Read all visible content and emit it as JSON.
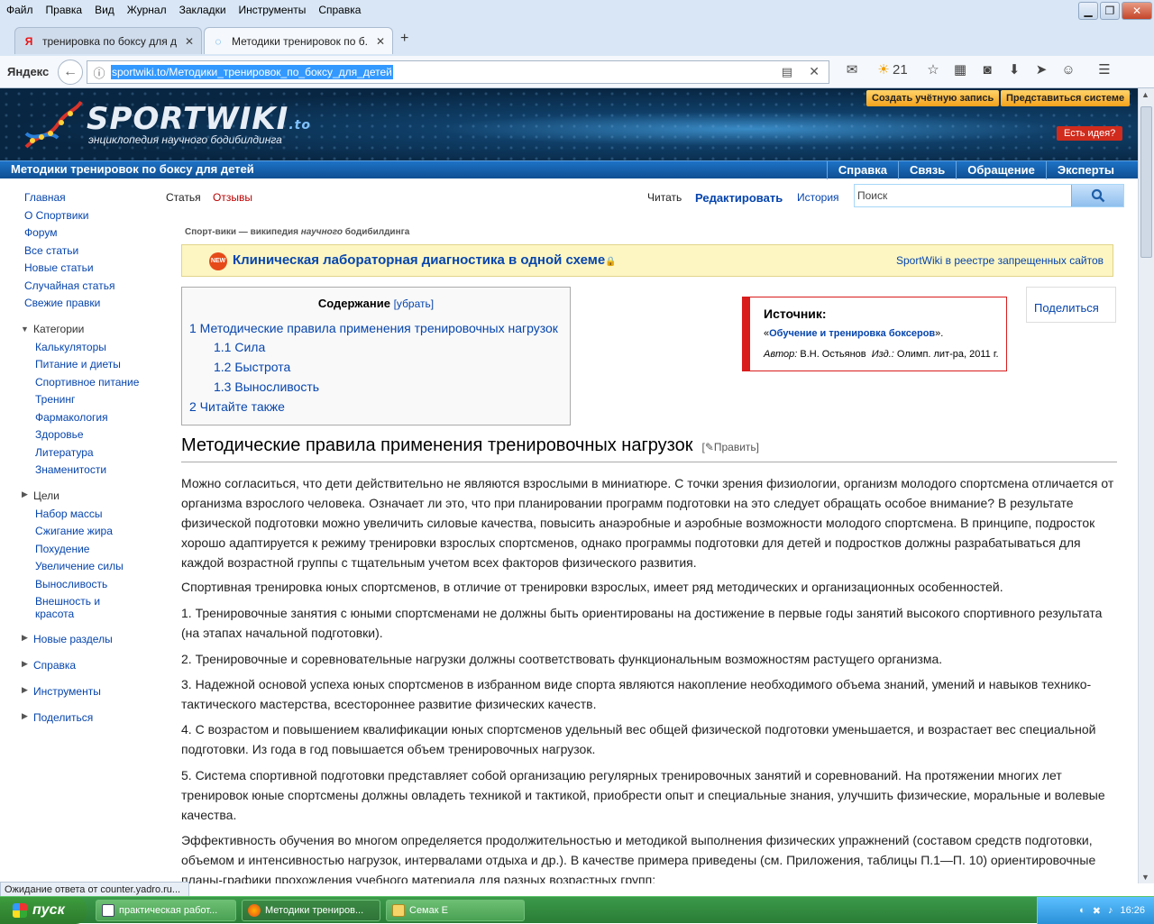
{
  "menu": [
    "Файл",
    "Правка",
    "Вид",
    "Журнал",
    "Закладки",
    "Инструменты",
    "Справка"
  ],
  "tabs": [
    {
      "label": "тренировка по боксу для д...",
      "favicon": "Я"
    },
    {
      "label": "Методики тренировок по б...",
      "favicon": "◌"
    }
  ],
  "nav": {
    "brand": "Яндекс",
    "url": "sportwiki.to/Методики_тренировок_по_боксу_для_детей",
    "weather": "21"
  },
  "site": {
    "logo": "SPORTWIKI",
    "logo_tld": ".to",
    "tagline": "энциклопедия научного бодибилдинга",
    "create_account": "Создать учётную запись",
    "login": "Представиться системе",
    "idea": "Есть идея?",
    "page_title": "Методики тренировок по боксу для детей",
    "top_links": [
      "Справка",
      "Связь",
      "Обращение",
      "Эксперты"
    ]
  },
  "sidebar": {
    "main": [
      "Главная",
      "О Спортвики",
      "Форум",
      "Все статьи",
      "Новые статьи",
      "Случайная статья",
      "Свежие правки"
    ],
    "categories_label": "Категории",
    "categories": [
      "Калькуляторы",
      "Питание и диеты",
      "Спортивное питание",
      "Тренинг",
      "Фармакология",
      "Здоровье",
      "Литература",
      "Знаменитости"
    ],
    "goals_label": "Цели",
    "goals": [
      "Набор массы",
      "Сжигание жира",
      "Похудение",
      "Увеличение силы",
      "Выносливость",
      "Внешность и",
      "красота"
    ],
    "sections": [
      "Новые разделы",
      "Справка",
      "Инструменты",
      "Поделиться"
    ]
  },
  "page_tabs": {
    "article": "Статья",
    "reviews": "Отзывы",
    "read": "Читать",
    "edit": "Редактировать",
    "history": "История",
    "search_placeholder": "Поиск"
  },
  "motto_pre": "Спорт-вики — википедия ",
  "motto_em": "научного",
  "motto_post": " бодибилдинга",
  "promo": {
    "icon": "NEW",
    "text": "Клиническая лабораторная диагностика в одной схеме",
    "lock": "🔒",
    "right": "SportWiki в реестре запрещенных сайтов"
  },
  "toc": {
    "title": "Содержание",
    "toggle": "[убрать]",
    "items": [
      "1 Методические правила применения тренировочных нагрузок",
      "1.1 Сила",
      "1.2 Быстрота",
      "1.3 Выносливость",
      "2 Читайте также"
    ]
  },
  "source": {
    "heading": "Источник:",
    "book_pre": "«",
    "book": "Обучение и тренировка боксеров",
    "book_post": "».",
    "author_label": "Автор:",
    "author": "В.Н. Остьянов",
    "pub_label": "Изд.:",
    "pub": "Олимп. лит-ра, 2011 г."
  },
  "share": "Поделиться",
  "section": {
    "heading": "Методические правила применения тренировочных нагрузок",
    "edit": "[✎Править]"
  },
  "paragraphs": [
    "Можно согласиться, что дети действительно не являются взрослыми в миниатюре. С точки зрения физиологии, организм молодого спортсмена отличается от организма взрослого человека. Означает ли это, что при планировании программ подготовки на это следует обращать особое внимание? В результате физической подготовки можно увеличить силовые качества, повысить анаэробные и аэробные возможности молодого спортсмена. В принципе, подросток хорошо адаптируется к режиму тренировки взрослых спортсменов, однако программы подготовки для детей и подростков должны разрабатываться для каждой возрастной группы с тщательным учетом всех факторов физического развития.",
    "Спортивная тренировка юных спортсменов, в отличие от тренировки взрослых, имеет ряд методических и организационных особенностей.",
    "1. Тренировочные занятия с юными спортсменами не должны быть ориентированы на достижение в первые годы занятий высокого спортивного результата (на этапах начальной подготовки).",
    "2. Тренировочные и соревновательные нагрузки должны соответствовать функциональным возможностям растущего организма.",
    "3. Надежной основой успеха юных спортсменов в избранном виде спорта являются накопление необходимого объема знаний, умений и навыков технико-тактического мастерства, всестороннее развитие физических качеств.",
    "4. С возрастом и повышением квалификации юных спортсменов удельный вес общей физической подготовки уменьшается, и возрастает вес специальной подготовки. Из года в год повышается объем тренировочных нагрузок.",
    "5. Система спортивной подготовки представляет собой организацию регулярных тренировочных занятий и соревнований. На протяжении многих лет тренировок юные спортсмены должны овладеть техникой и тактикой, приобрести опыт и специальные знания, улучшить физические, моральные и волевые качества.",
    "Эффективность обучения во многом определяется продолжительностью и методикой выполнения физических упражнений (составом средств подготовки, объемом и интенсивностью нагрузок, интервалами отдыха и др.). В качестве примера приведены (см. Приложения, таблицы П.1—П. 10) ориентировочные планы-графики прохождения учебного материала для разных возрастных групп:"
  ],
  "status": "Ожидание ответа от counter.yadro.ru...",
  "taskbar": {
    "start": "пуск",
    "items": [
      "практическая работ...",
      "Методики трениров...",
      "Семак Е"
    ],
    "lang": "RU",
    "clock": "16:26"
  }
}
